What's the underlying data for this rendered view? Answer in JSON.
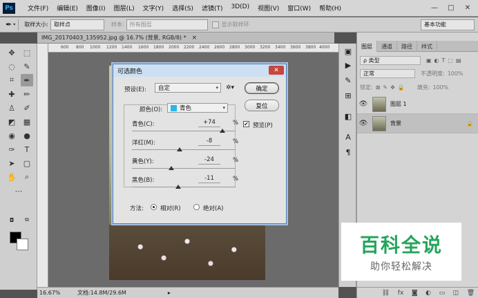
{
  "menubar": {
    "logo": "Ps",
    "items": [
      "文件(F)",
      "编辑(E)",
      "图像(I)",
      "图层(L)",
      "文字(Y)",
      "选择(S)",
      "滤镜(T)",
      "3D(D)",
      "视图(V)",
      "窗口(W)",
      "帮助(H)"
    ],
    "window_controls": [
      "—",
      "□",
      "✕"
    ]
  },
  "optionsbar": {
    "sample_size_label": "取样大小:",
    "sample_size_value": "取样点",
    "sample_label": "样本:",
    "sample_value": "所有图层",
    "show_ring_label": "显示取样环",
    "workspace": "基本功能"
  },
  "document": {
    "tab_label": "IMG_20170403_135952.jpg @ 16.7% (背景, RGB/8) *",
    "close": "×",
    "ruler_ticks": [
      "600",
      "800",
      "1000",
      "1200",
      "1400",
      "1600",
      "1800",
      "2000",
      "2200",
      "2400",
      "2600",
      "2800",
      "3000",
      "3200",
      "3400",
      "3600",
      "3800",
      "4000",
      "4200"
    ]
  },
  "statusbar": {
    "zoom": "16.67%",
    "doc_size": "文档:14.8M/29.6M"
  },
  "dialog": {
    "title": "可选颜色",
    "close": "✕",
    "preset_label": "预设(E):",
    "preset_value": "自定",
    "ok": "确定",
    "reset": "复位",
    "preview_label": "预览(P)",
    "preview_checked": "✔",
    "colors_label": "颜色(O):",
    "colors_value": "青色",
    "colors_swatch": "#29b6e8",
    "sliders": [
      {
        "name": "青色(C):",
        "value": "+74",
        "unit": "%",
        "level": 0.87
      },
      {
        "name": "洋红(M):",
        "value": "-8",
        "unit": "%",
        "level": 0.46
      },
      {
        "name": "黄色(Y):",
        "value": "-24",
        "unit": "%",
        "level": 0.38
      },
      {
        "name": "黑色(B):",
        "value": "-11",
        "unit": "%",
        "level": 0.445
      }
    ],
    "method_label": "方法:",
    "method_relative": "相对(R)",
    "method_absolute": "绝对(A)"
  },
  "layers_panel": {
    "tabs": [
      "图层",
      "通道",
      "路径",
      "样式"
    ],
    "kind_filter": "ρ 类型",
    "blend_mode": "正常",
    "opacity_label": "不透明度:",
    "opacity_value": "100%",
    "lock_label": "锁定:",
    "fill_label": "填充:",
    "fill_value": "100%",
    "layers": [
      {
        "name": "图层 1",
        "selected": false
      },
      {
        "name": "背景",
        "selected": true
      }
    ]
  },
  "watermark": {
    "title": "百科全说",
    "subtitle": "助你轻松解决"
  },
  "colors": {
    "title_accent": "#25a55c",
    "dialog_border": "#4f7cae",
    "close_red": "#c7463c"
  }
}
